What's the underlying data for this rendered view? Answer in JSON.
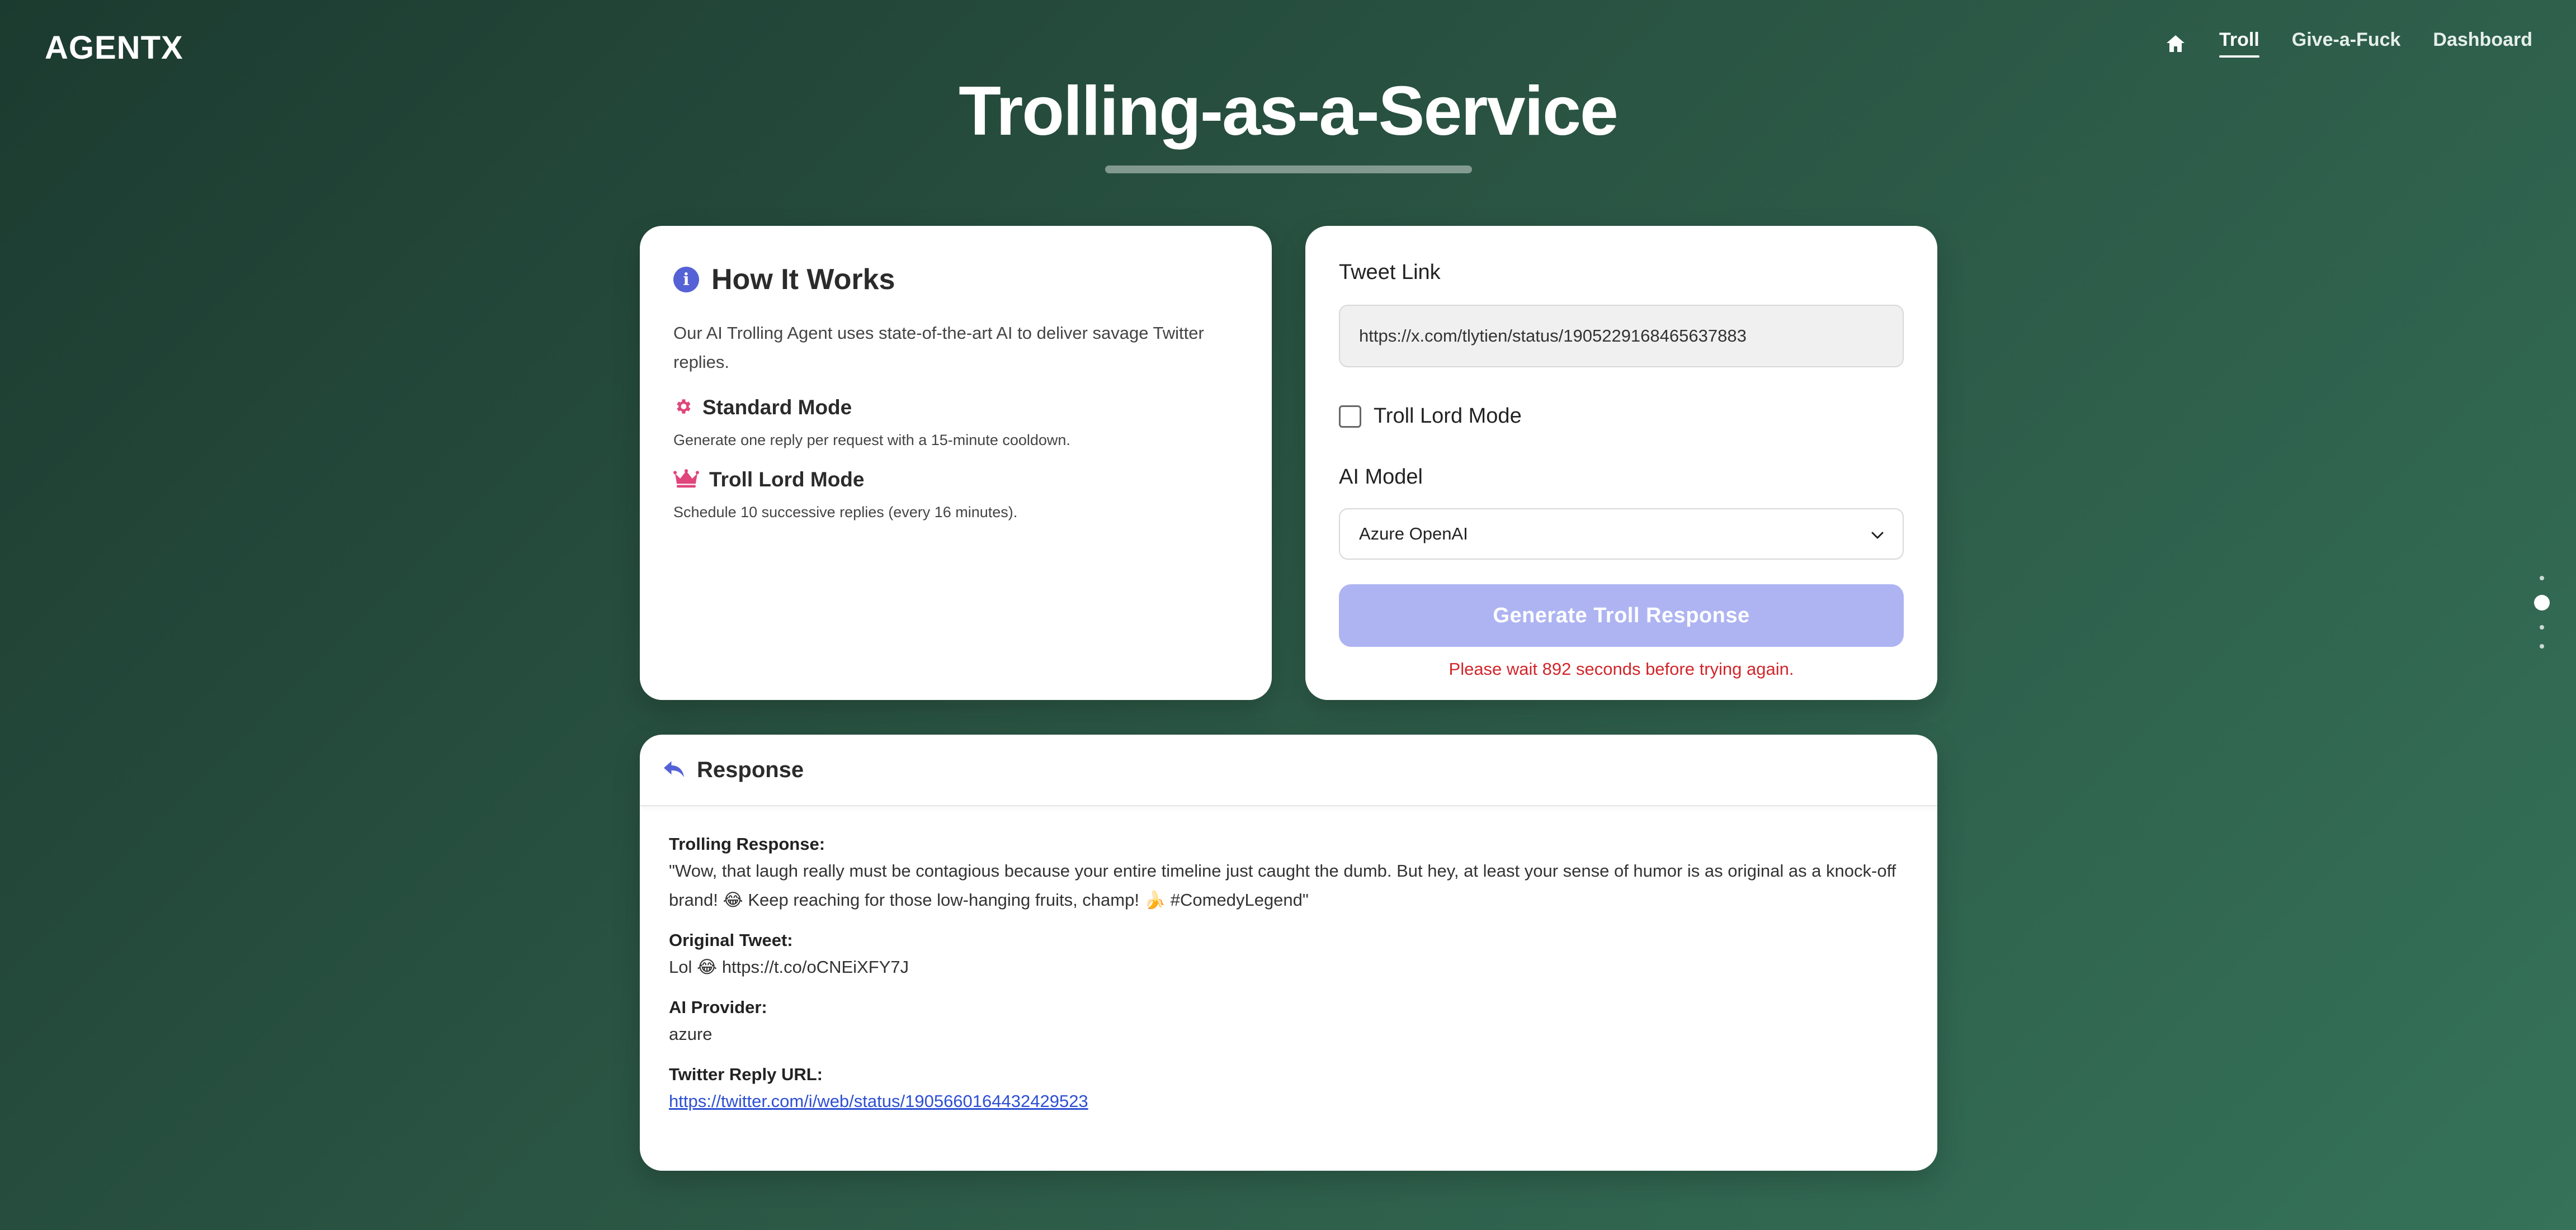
{
  "brand": {
    "logo": "AGENTX"
  },
  "nav": {
    "home_icon": "home-icon",
    "links": [
      {
        "label": "Troll",
        "active": true
      },
      {
        "label": "Give-a-Fuck",
        "active": false
      },
      {
        "label": "Dashboard",
        "active": false
      }
    ]
  },
  "page": {
    "title": "Trolling-as-a-Service"
  },
  "how_it_works": {
    "title": "How It Works",
    "icon": "info-icon",
    "description": "Our AI Trolling Agent uses state-of-the-art AI to deliver savage Twitter replies.",
    "modes": [
      {
        "icon": "gear-icon",
        "title": "Standard Mode",
        "description": "Generate one reply per request with a 15-minute cooldown."
      },
      {
        "icon": "crown-icon",
        "title": "Troll Lord Mode",
        "description": "Schedule 10 successive replies (every 16 minutes)."
      }
    ]
  },
  "form": {
    "tweet_link_label": "Tweet Link",
    "tweet_link_value": "https://x.com/tlytien/status/1905229168465637883",
    "troll_lord_label": "Troll Lord Mode",
    "troll_lord_checked": false,
    "ai_model_label": "AI Model",
    "ai_model_selected": "Azure OpenAI",
    "generate_button": "Generate Troll Response",
    "wait_message": "Please wait 892 seconds before trying again."
  },
  "response": {
    "title": "Response",
    "icon": "reply-icon",
    "fields": [
      {
        "label": "Trolling Response:",
        "value": "\"Wow, that laugh really must be contagious because your entire timeline just caught the dumb. But hey, at least your sense of humor is as original as a knock-off brand! 😂 Keep reaching for those low-hanging fruits, champ! 🍌 #ComedyLegend\""
      },
      {
        "label": "Original Tweet:",
        "value": "Lol 😂 https://t.co/oCNEiXFY7J"
      },
      {
        "label": "AI Provider:",
        "value": "azure"
      },
      {
        "label": "Twitter Reply URL:",
        "value": "https://twitter.com/i/web/status/1905660164432429523"
      }
    ]
  },
  "colors": {
    "accent": "#5562d6",
    "button_disabled": "#aeb4f2",
    "error": "#d2262b",
    "mode_icon": "#e0457b",
    "link": "#2d4fd4"
  }
}
